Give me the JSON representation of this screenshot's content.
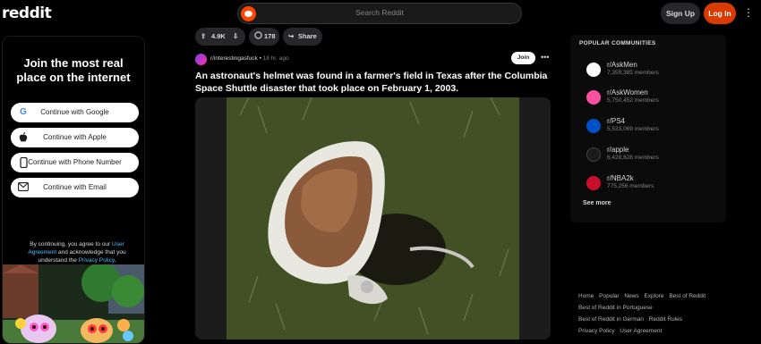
{
  "header": {
    "logo": "reddit",
    "search_placeholder": "Search Reddit",
    "signup_label": "Sign Up",
    "login_label": "Log In",
    "more_icon": "ellipsis-vertical-icon"
  },
  "join_panel": {
    "headline": "Join the most real place on the internet",
    "buttons": [
      {
        "label": "Continue with Google",
        "icon": "google-icon"
      },
      {
        "label": "Continue with Apple",
        "icon": "apple-icon"
      },
      {
        "label": "Continue with Phone Number",
        "icon": "phone-icon"
      },
      {
        "label": "Continue with Email",
        "icon": "email-icon"
      }
    ],
    "terms_prefix": "By continuing, you agree to our",
    "terms_link1": "User Agreement",
    "terms_mid": "and acknowledge that you understand the",
    "terms_link2": "Privacy Policy",
    "terms_suffix": "."
  },
  "post": {
    "votes": "4.9K",
    "comments": "178",
    "share_label": "Share",
    "subreddit": "r/interestingasfuck",
    "separator": "•",
    "time": "18 hr. ago",
    "join_label": "Join",
    "title": "An astronaut's helmet was found in a farmer's field in Texas after the Columbia Space Shuttle disaster that took place on February 1, 2003."
  },
  "communities": {
    "heading": "POPULAR COMMUNITIES",
    "items": [
      {
        "name": "r/AskMen",
        "members": "7,359,385 members",
        "color": "#ffffff"
      },
      {
        "name": "r/AskWomen",
        "members": "5,750,452 members",
        "color": "#ff4fa0"
      },
      {
        "name": "r/PS4",
        "members": "5,533,069 members",
        "color": "#0050c8"
      },
      {
        "name": "r/apple",
        "members": "6,428,628 members",
        "color": "#1a1a1a"
      },
      {
        "name": "r/NBA2k",
        "members": "775,256 members",
        "color": "#c8102e"
      }
    ],
    "see_more": "See more"
  },
  "footer": {
    "links": [
      "Home",
      "Popular",
      "News",
      "Explore",
      "Best of Reddit",
      "Best of Reddit in Portuguese",
      "Best of Reddit in German",
      "Reddit Rules",
      "Privacy Policy",
      "User Agreement"
    ]
  },
  "colors": {
    "brand": "#ff4500",
    "login": "#d93a00",
    "link": "#4fbcff"
  }
}
